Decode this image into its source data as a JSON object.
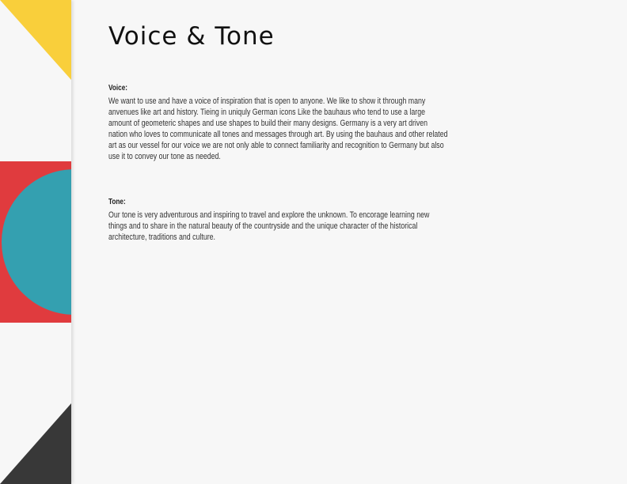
{
  "page": {
    "title": "Voice & Tone"
  },
  "voice": {
    "heading": "Voice:",
    "body": "We want to use and have a voice of inspiration that is open to anyone. We like to show it through many anvenues like art and history. Tieing in uniquly German icons Like the bauhaus who tend to use a large amount of geometeric shapes and use shapes to build their many designs. Germany is a very art driven nation who loves to communicate all tones and messages through art. By using the bauhaus and other related art as our vessel for our voice we are not only able to connect familiarity and recognition to Germany but also use it to convey our tone as needed."
  },
  "tone": {
    "heading": "Tone:",
    "body": "Our tone is very adventurous and inspiring to travel and explore the unknown. To encorage learning new things and to share in the natural beauty of the countryside and the unique character of the historical architecture, traditions and culture."
  },
  "colors": {
    "yellow": "#f9cf3b",
    "red": "#e03b3e",
    "teal": "#34a0b0",
    "dark": "#383838",
    "background": "#f7f7f7"
  }
}
